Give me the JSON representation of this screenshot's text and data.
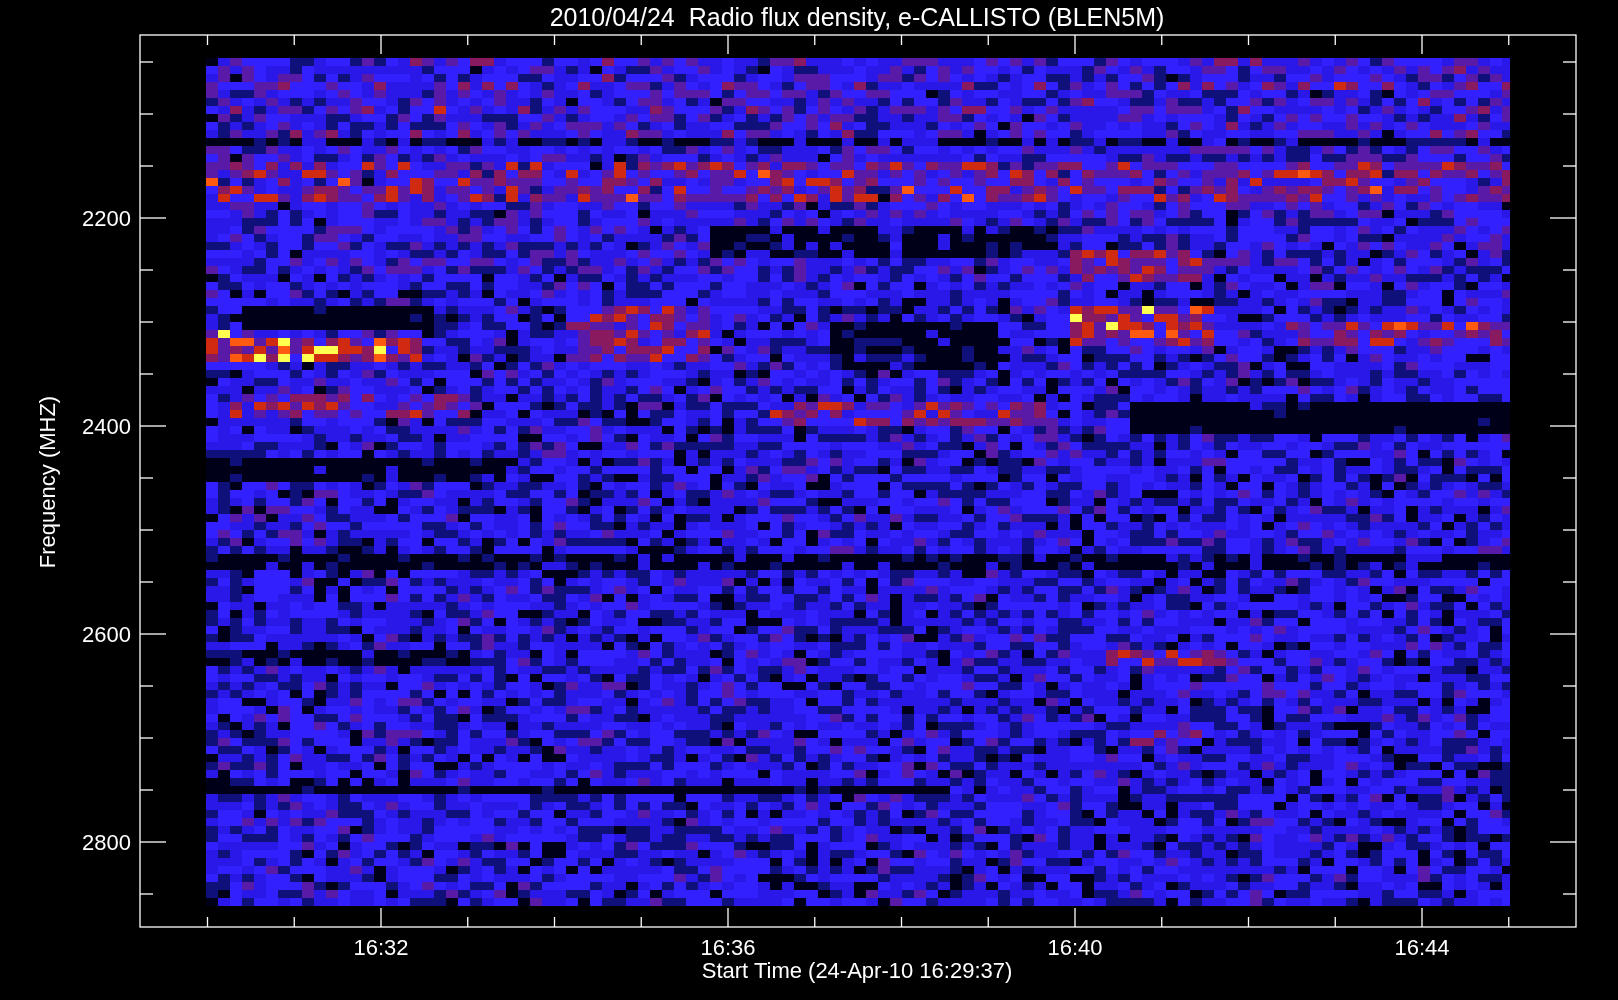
{
  "title": "2010/04/24  Radio flux density, e-CALLISTO (BLEN5M)",
  "y_axis": {
    "label": "Frequency (MHZ)",
    "ticks": [
      "2200",
      "2400",
      "2600",
      "2800"
    ]
  },
  "x_axis": {
    "label": "Start Time (24-Apr-10 16:29:37)",
    "ticks": [
      "16:32",
      "16:36",
      "16:40",
      "16:44"
    ]
  }
}
